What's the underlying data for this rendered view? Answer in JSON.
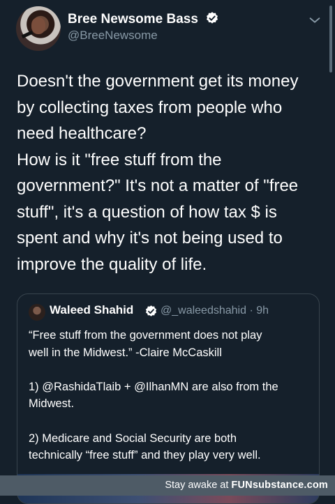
{
  "tweet": {
    "author": {
      "display_name": "Bree Newsome Bass",
      "handle": "@BreeNewsome",
      "verified": true
    },
    "text": "Doesn't the government get its money\nby collecting taxes from people who\nneed healthcare?\nHow is it \"free stuff from the\ngovernment?\" It's not a matter of \"free\nstuff\", it's a question of how tax $ is\nspent and why it's not being used to\nimprove the quality of life."
  },
  "quoted_tweet": {
    "author": {
      "display_name": "Waleed Shahid",
      "handle_time": "@_waleedshahid · 9h",
      "verified": true
    },
    "text": "“Free stuff from the government does not play\nwell in the Midwest.” -Claire McCaskill\n\n1) @RashidaTlaib + @IlhanMN are also from the\nMidwest.\n\n2) Medicare and Social Security are both\ntechnically “free stuff” and they play very well."
  },
  "footer": {
    "prefix": "Stay awake at ",
    "brand": "FUNsubstance.com"
  },
  "colors": {
    "background": "#15202b",
    "verified_badge": "#ffffff",
    "secondary_text": "#8899a6",
    "border": "#38444d",
    "footer_bar": "#4e5b66"
  },
  "icons": [
    "verified-badge-icon",
    "chevron-down-icon"
  ]
}
